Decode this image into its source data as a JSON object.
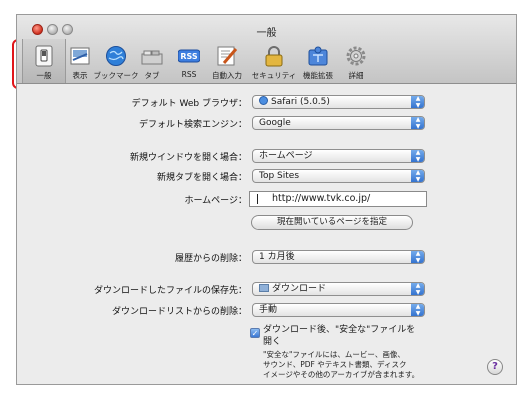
{
  "window": {
    "title": "一般"
  },
  "toolbar": [
    {
      "label": "一般",
      "icon": "switch-icon"
    },
    {
      "label": "表示",
      "icon": "appearance-icon"
    },
    {
      "label": "ブックマーク",
      "icon": "globe-icon"
    },
    {
      "label": "タブ",
      "icon": "tabs-icon"
    },
    {
      "label": "RSS",
      "icon": "rss-icon"
    },
    {
      "label": "自動入力",
      "icon": "pencil-icon"
    },
    {
      "label": "セキュリティ",
      "icon": "lock-icon"
    },
    {
      "label": "機能拡張",
      "icon": "puzzle-icon"
    },
    {
      "label": "詳細",
      "icon": "gear-icon"
    }
  ],
  "settings": {
    "default_browser": {
      "label": "デフォルト Web ブラウザ：",
      "value": "Safari (5.0.5)"
    },
    "default_search": {
      "label": "デフォルト検索エンジン：",
      "value": "Google"
    },
    "new_window": {
      "label": "新規ウインドウを開く場合：",
      "value": "ホームページ"
    },
    "new_tab": {
      "label": "新規タブを開く場合：",
      "value": "Top Sites"
    },
    "homepage": {
      "label": "ホームページ：",
      "value": "http://www.tvk.co.jp/",
      "set_current_button": "現在開いているページを指定"
    },
    "history_remove": {
      "label": "履歴からの削除：",
      "value": "1 カ月後"
    },
    "download_location": {
      "label": "ダウンロードしたファイルの保存先：",
      "value": "ダウンロード"
    },
    "download_list_remove": {
      "label": "ダウンロードリストからの削除：",
      "value": "手動"
    },
    "open_safe_files": {
      "checked": true,
      "label_line1": "ダウンロード後、\"安全な\"ファイルを",
      "label_line2": "開く",
      "note_line1": "\"安全な\"ファイルには、ムービー、画像、",
      "note_line2": "サウンド、PDF やテキスト書類、ディスク",
      "note_line3": "イメージやその他のアーカイブが含まれます。"
    }
  },
  "help_label": "?",
  "colors": {
    "highlight": "#e0161a",
    "popup_arrow": "#2f6fcd"
  }
}
